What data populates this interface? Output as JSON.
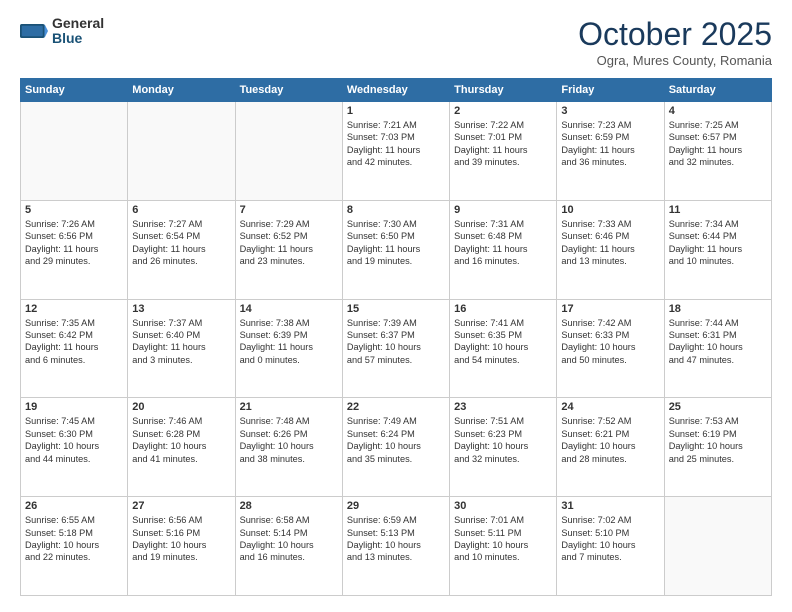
{
  "logo": {
    "general": "General",
    "blue": "Blue"
  },
  "title": "October 2025",
  "location": "Ogra, Mures County, Romania",
  "days_header": [
    "Sunday",
    "Monday",
    "Tuesday",
    "Wednesday",
    "Thursday",
    "Friday",
    "Saturday"
  ],
  "weeks": [
    [
      {
        "day": "",
        "info": ""
      },
      {
        "day": "",
        "info": ""
      },
      {
        "day": "",
        "info": ""
      },
      {
        "day": "1",
        "info": "Sunrise: 7:21 AM\nSunset: 7:03 PM\nDaylight: 11 hours\nand 42 minutes."
      },
      {
        "day": "2",
        "info": "Sunrise: 7:22 AM\nSunset: 7:01 PM\nDaylight: 11 hours\nand 39 minutes."
      },
      {
        "day": "3",
        "info": "Sunrise: 7:23 AM\nSunset: 6:59 PM\nDaylight: 11 hours\nand 36 minutes."
      },
      {
        "day": "4",
        "info": "Sunrise: 7:25 AM\nSunset: 6:57 PM\nDaylight: 11 hours\nand 32 minutes."
      }
    ],
    [
      {
        "day": "5",
        "info": "Sunrise: 7:26 AM\nSunset: 6:56 PM\nDaylight: 11 hours\nand 29 minutes."
      },
      {
        "day": "6",
        "info": "Sunrise: 7:27 AM\nSunset: 6:54 PM\nDaylight: 11 hours\nand 26 minutes."
      },
      {
        "day": "7",
        "info": "Sunrise: 7:29 AM\nSunset: 6:52 PM\nDaylight: 11 hours\nand 23 minutes."
      },
      {
        "day": "8",
        "info": "Sunrise: 7:30 AM\nSunset: 6:50 PM\nDaylight: 11 hours\nand 19 minutes."
      },
      {
        "day": "9",
        "info": "Sunrise: 7:31 AM\nSunset: 6:48 PM\nDaylight: 11 hours\nand 16 minutes."
      },
      {
        "day": "10",
        "info": "Sunrise: 7:33 AM\nSunset: 6:46 PM\nDaylight: 11 hours\nand 13 minutes."
      },
      {
        "day": "11",
        "info": "Sunrise: 7:34 AM\nSunset: 6:44 PM\nDaylight: 11 hours\nand 10 minutes."
      }
    ],
    [
      {
        "day": "12",
        "info": "Sunrise: 7:35 AM\nSunset: 6:42 PM\nDaylight: 11 hours\nand 6 minutes."
      },
      {
        "day": "13",
        "info": "Sunrise: 7:37 AM\nSunset: 6:40 PM\nDaylight: 11 hours\nand 3 minutes."
      },
      {
        "day": "14",
        "info": "Sunrise: 7:38 AM\nSunset: 6:39 PM\nDaylight: 11 hours\nand 0 minutes."
      },
      {
        "day": "15",
        "info": "Sunrise: 7:39 AM\nSunset: 6:37 PM\nDaylight: 10 hours\nand 57 minutes."
      },
      {
        "day": "16",
        "info": "Sunrise: 7:41 AM\nSunset: 6:35 PM\nDaylight: 10 hours\nand 54 minutes."
      },
      {
        "day": "17",
        "info": "Sunrise: 7:42 AM\nSunset: 6:33 PM\nDaylight: 10 hours\nand 50 minutes."
      },
      {
        "day": "18",
        "info": "Sunrise: 7:44 AM\nSunset: 6:31 PM\nDaylight: 10 hours\nand 47 minutes."
      }
    ],
    [
      {
        "day": "19",
        "info": "Sunrise: 7:45 AM\nSunset: 6:30 PM\nDaylight: 10 hours\nand 44 minutes."
      },
      {
        "day": "20",
        "info": "Sunrise: 7:46 AM\nSunset: 6:28 PM\nDaylight: 10 hours\nand 41 minutes."
      },
      {
        "day": "21",
        "info": "Sunrise: 7:48 AM\nSunset: 6:26 PM\nDaylight: 10 hours\nand 38 minutes."
      },
      {
        "day": "22",
        "info": "Sunrise: 7:49 AM\nSunset: 6:24 PM\nDaylight: 10 hours\nand 35 minutes."
      },
      {
        "day": "23",
        "info": "Sunrise: 7:51 AM\nSunset: 6:23 PM\nDaylight: 10 hours\nand 32 minutes."
      },
      {
        "day": "24",
        "info": "Sunrise: 7:52 AM\nSunset: 6:21 PM\nDaylight: 10 hours\nand 28 minutes."
      },
      {
        "day": "25",
        "info": "Sunrise: 7:53 AM\nSunset: 6:19 PM\nDaylight: 10 hours\nand 25 minutes."
      }
    ],
    [
      {
        "day": "26",
        "info": "Sunrise: 6:55 AM\nSunset: 5:18 PM\nDaylight: 10 hours\nand 22 minutes."
      },
      {
        "day": "27",
        "info": "Sunrise: 6:56 AM\nSunset: 5:16 PM\nDaylight: 10 hours\nand 19 minutes."
      },
      {
        "day": "28",
        "info": "Sunrise: 6:58 AM\nSunset: 5:14 PM\nDaylight: 10 hours\nand 16 minutes."
      },
      {
        "day": "29",
        "info": "Sunrise: 6:59 AM\nSunset: 5:13 PM\nDaylight: 10 hours\nand 13 minutes."
      },
      {
        "day": "30",
        "info": "Sunrise: 7:01 AM\nSunset: 5:11 PM\nDaylight: 10 hours\nand 10 minutes."
      },
      {
        "day": "31",
        "info": "Sunrise: 7:02 AM\nSunset: 5:10 PM\nDaylight: 10 hours\nand 7 minutes."
      },
      {
        "day": "",
        "info": ""
      }
    ]
  ]
}
